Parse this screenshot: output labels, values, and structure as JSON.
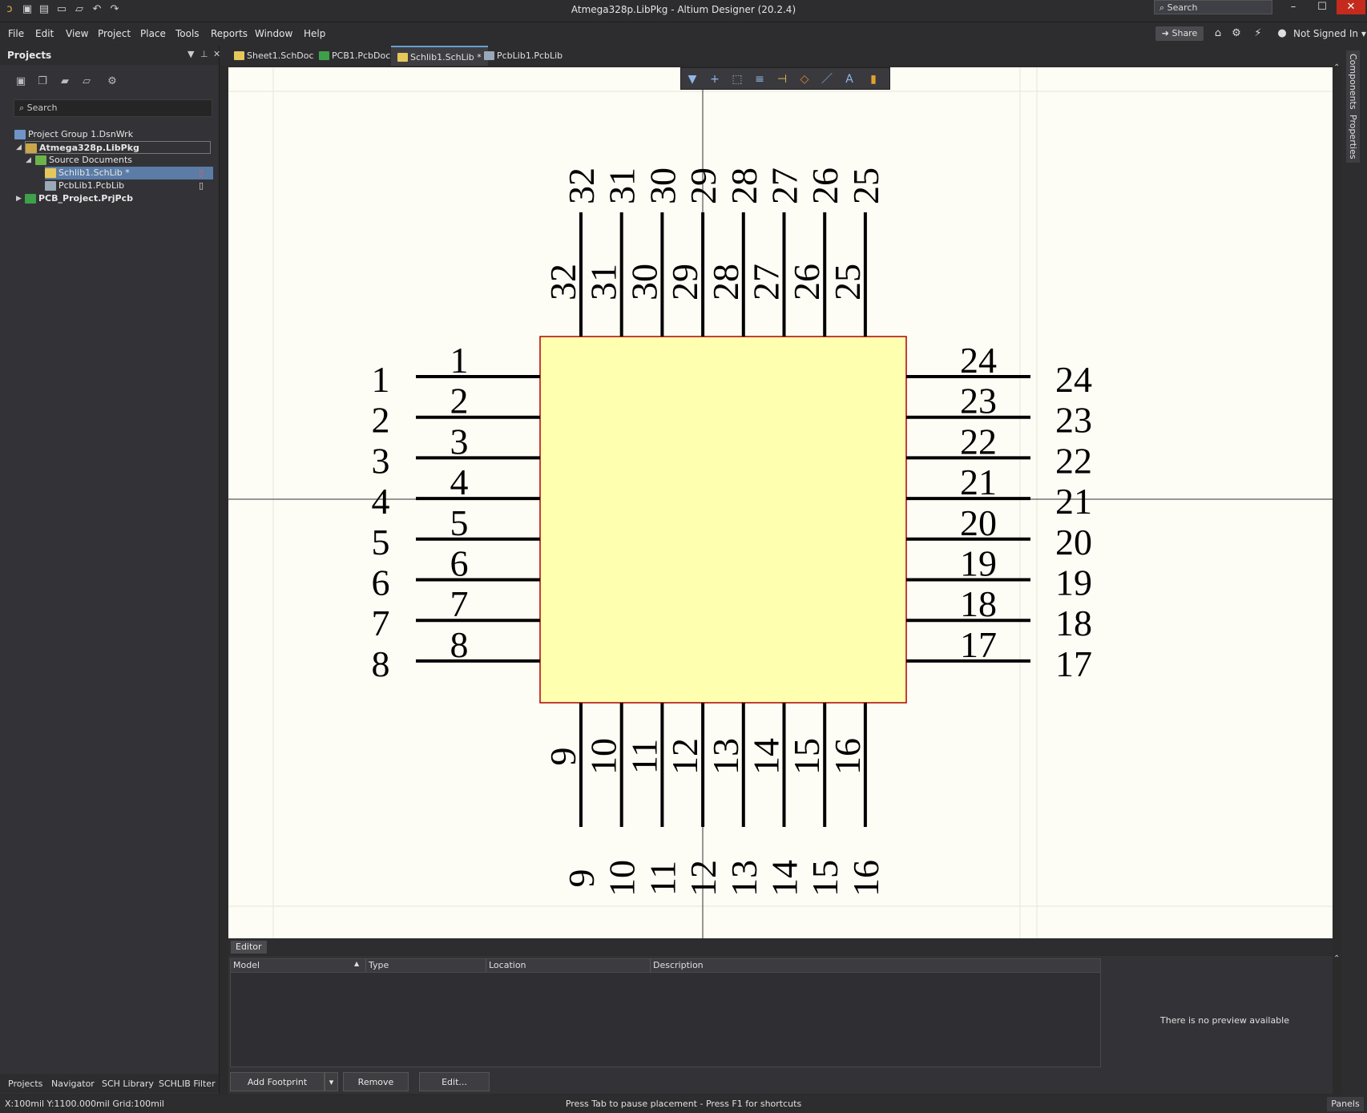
{
  "window": {
    "title": "Atmega328p.LibPkg - Altium Designer (20.2.4)",
    "search_placeholder": "Search",
    "minimize": "–",
    "maximize": "☐",
    "close": "✕"
  },
  "menu": {
    "items": [
      "File",
      "Edit",
      "View",
      "Project",
      "Place",
      "Tools",
      "Reports",
      "Window",
      "Help"
    ],
    "share": "Share",
    "user": "Not Signed In"
  },
  "projects_panel": {
    "title": "Projects",
    "search_placeholder": "Search",
    "tree": [
      {
        "label": "Project Group 1.DsnWrk"
      },
      {
        "label": "Atmega328p.LibPkg"
      },
      {
        "label": "Source Documents"
      },
      {
        "label": "Schlib1.SchLib *"
      },
      {
        "label": "PcbLib1.PcbLib"
      },
      {
        "label": "PCB_Project.PrjPcb"
      }
    ],
    "bottom_tabs": [
      "Projects",
      "Navigator",
      "SCH Library",
      "SCHLIB Filter"
    ]
  },
  "doc_tabs": [
    {
      "label": "Sheet1.SchDoc"
    },
    {
      "label": "PCB1.PcbDoc"
    },
    {
      "label": "Schlib1.SchLib *"
    },
    {
      "label": "PcbLib1.PcbLib"
    }
  ],
  "right_dock": {
    "tabs": [
      "Components",
      "Properties"
    ]
  },
  "component": {
    "body_fill": "#ffffb0",
    "body_border": "#b00000",
    "pins_left": [
      "1",
      "2",
      "3",
      "4",
      "5",
      "6",
      "7",
      "8"
    ],
    "pins_bottom": [
      "9",
      "10",
      "11",
      "12",
      "13",
      "14",
      "15",
      "16"
    ],
    "pins_right": [
      "24",
      "23",
      "22",
      "21",
      "20",
      "19",
      "18",
      "17"
    ],
    "pins_top": [
      "32",
      "31",
      "30",
      "29",
      "28",
      "27",
      "26",
      "25"
    ]
  },
  "editor": {
    "tab": "Editor",
    "columns": [
      "Model",
      "Type",
      "Location",
      "Description"
    ],
    "preview": "There is no preview available",
    "buttons": {
      "add_footprint": "Add Footprint",
      "remove": "Remove",
      "edit": "Edit..."
    }
  },
  "status": {
    "coords": "X:100mil Y:1100.000mil   Grid:100mil",
    "message": "Press Tab to pause placement - Press F1 for shortcuts",
    "panels": "Panels"
  }
}
